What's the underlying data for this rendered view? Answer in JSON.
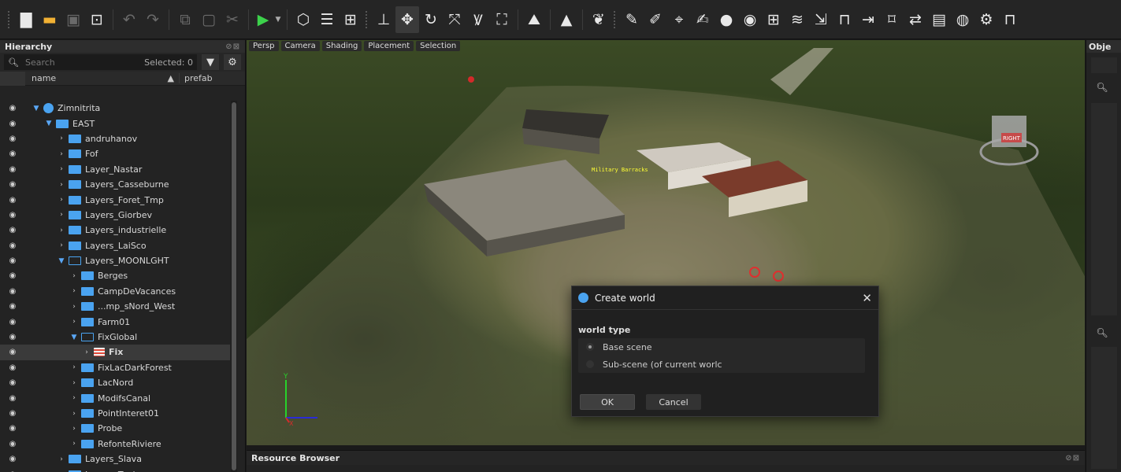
{
  "toolbar": {
    "buttons": [
      {
        "name": "new-file-icon",
        "glyph": "▇"
      },
      {
        "name": "open-folder-icon",
        "glyph": "▬"
      },
      {
        "name": "save-icon",
        "glyph": "▣"
      },
      {
        "name": "save-as-icon",
        "glyph": "⊡"
      },
      {
        "name": "undo-icon",
        "glyph": "↶"
      },
      {
        "name": "redo-icon",
        "glyph": "↷"
      },
      {
        "name": "copy-icon",
        "glyph": "⧉"
      },
      {
        "name": "paste-icon",
        "glyph": "▢"
      },
      {
        "name": "cut-icon",
        "glyph": "✂"
      },
      {
        "name": "play-icon",
        "glyph": "▶"
      },
      {
        "name": "cube-icon",
        "glyph": "⬡"
      },
      {
        "name": "layers-icon",
        "glyph": "☰"
      },
      {
        "name": "select-rect-icon",
        "glyph": "⊞"
      },
      {
        "name": "ground-snap-icon",
        "glyph": "⊥"
      },
      {
        "name": "move-icon",
        "glyph": "✥"
      },
      {
        "name": "rotate-icon",
        "glyph": "↻"
      },
      {
        "name": "scale-icon",
        "glyph": "⤧"
      },
      {
        "name": "curve-icon",
        "glyph": "Ꝟ"
      },
      {
        "name": "frame-icon",
        "glyph": "⛶"
      },
      {
        "name": "terrain-icon",
        "glyph": "⛰"
      },
      {
        "name": "tree-icon",
        "glyph": "▲"
      },
      {
        "name": "vegetation-icon",
        "glyph": "❦"
      },
      {
        "name": "pencil-icon",
        "glyph": "✎"
      },
      {
        "name": "eraser-icon",
        "glyph": "✐"
      },
      {
        "name": "map-pin-icon",
        "glyph": "⌖"
      },
      {
        "name": "brush-icon",
        "glyph": "✍"
      },
      {
        "name": "sphere-icon",
        "glyph": "●"
      },
      {
        "name": "drop-icon",
        "glyph": "◉"
      },
      {
        "name": "grid-icon",
        "glyph": "⊞"
      },
      {
        "name": "mountain-icon",
        "glyph": "≋"
      },
      {
        "name": "import-icon",
        "glyph": "⇲"
      },
      {
        "name": "network-icon",
        "glyph": "⊓"
      },
      {
        "name": "export-icon",
        "glyph": "⇥"
      },
      {
        "name": "crop-icon",
        "glyph": "⌑"
      },
      {
        "name": "swap-icon",
        "glyph": "⇄"
      },
      {
        "name": "package-icon",
        "glyph": "▤"
      },
      {
        "name": "globe-icon",
        "glyph": "◍"
      },
      {
        "name": "gears-icon",
        "glyph": "⚙"
      },
      {
        "name": "hierarchy-icon",
        "glyph": "⊓"
      }
    ]
  },
  "hierarchy": {
    "title": "Hierarchy",
    "search_placeholder": "Search",
    "selected_label": "Selected: 0",
    "columns": {
      "name": "name",
      "prefab": "prefab"
    },
    "rows": [
      {
        "label": "Zimnitrita",
        "depth": 0,
        "kind": "world",
        "open": true
      },
      {
        "label": "EAST",
        "depth": 1,
        "kind": "folder",
        "open": true
      },
      {
        "label": "andruhanov",
        "depth": 2,
        "kind": "folder",
        "open": false
      },
      {
        "label": "Fof",
        "depth": 2,
        "kind": "folder",
        "open": false
      },
      {
        "label": "Layer_Nastar",
        "depth": 2,
        "kind": "folder",
        "open": false
      },
      {
        "label": "Layers_Casseburne",
        "depth": 2,
        "kind": "folder",
        "open": false
      },
      {
        "label": "Layers_Foret_Tmp",
        "depth": 2,
        "kind": "folder",
        "open": false
      },
      {
        "label": "Layers_Giorbev",
        "depth": 2,
        "kind": "folder",
        "open": false
      },
      {
        "label": "Layers_industrielle",
        "depth": 2,
        "kind": "folder",
        "open": false
      },
      {
        "label": "Layers_LaiSco",
        "depth": 2,
        "kind": "folder",
        "open": false
      },
      {
        "label": "Layers_MOONLGHT",
        "depth": 2,
        "kind": "folder-open",
        "open": true
      },
      {
        "label": "Berges",
        "depth": 3,
        "kind": "folder",
        "open": false
      },
      {
        "label": "CampDeVacances",
        "depth": 3,
        "kind": "folder",
        "open": false
      },
      {
        "label": "...mp_sNord_West",
        "depth": 3,
        "kind": "folder",
        "open": false
      },
      {
        "label": "Farm01",
        "depth": 3,
        "kind": "folder",
        "open": false
      },
      {
        "label": "FixGlobal",
        "depth": 3,
        "kind": "folder-open",
        "open": true
      },
      {
        "label": "Fix",
        "depth": 4,
        "kind": "layer",
        "open": false,
        "selected": true
      },
      {
        "label": "FixLacDarkForest",
        "depth": 3,
        "kind": "folder",
        "open": false
      },
      {
        "label": "LacNord",
        "depth": 3,
        "kind": "folder",
        "open": false
      },
      {
        "label": "ModifsCanal",
        "depth": 3,
        "kind": "folder",
        "open": false
      },
      {
        "label": "PointInteret01",
        "depth": 3,
        "kind": "folder",
        "open": false
      },
      {
        "label": "Probe",
        "depth": 3,
        "kind": "folder",
        "open": false
      },
      {
        "label": "RefonteRiviere",
        "depth": 3,
        "kind": "folder",
        "open": false
      },
      {
        "label": "Layers_Slava",
        "depth": 2,
        "kind": "folder",
        "open": false
      },
      {
        "label": "Layers_Tanin",
        "depth": 2,
        "kind": "folder",
        "open": false
      }
    ]
  },
  "viewport": {
    "tabs": [
      "Persp",
      "Camera",
      "Shading",
      "Placement",
      "Selection"
    ],
    "world_label": "Military Barracks",
    "gizmo_label": "RIGHT",
    "axis_y": "Y",
    "axis_x": "X"
  },
  "dialog": {
    "title": "Create world",
    "section_label": "world type",
    "options": [
      {
        "label": "Base scene",
        "checked": true
      },
      {
        "label": "Sub-scene (of current worlc",
        "checked": false
      }
    ],
    "ok_label": "OK",
    "cancel_label": "Cancel",
    "close_glyph": "✕"
  },
  "right_panel": {
    "title": "Obje"
  },
  "resource_browser": {
    "title": "Resource Browser"
  },
  "colors": {
    "accent": "#4aa3f0",
    "play": "#3cd24b",
    "folder_open": "#f2b134"
  }
}
